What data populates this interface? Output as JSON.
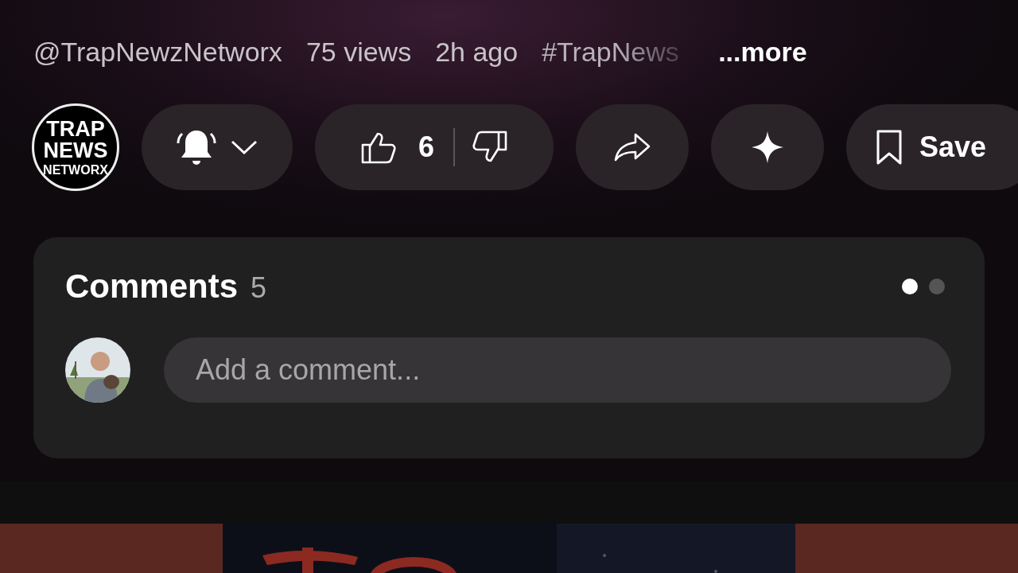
{
  "meta": {
    "channel": "@TrapNewzNetworx",
    "views": "75 views",
    "age": "2h ago",
    "hashtag": "#TrapNews",
    "more": "...more"
  },
  "actions": {
    "channel_logo": [
      "TRAP",
      "NEWS",
      "NETWORX"
    ],
    "like_count": "6",
    "save": "Save",
    "subscribed_bell": true
  },
  "comments": {
    "title": "Comments",
    "count": "5",
    "placeholder": "Add a comment...",
    "pages": [
      {
        "selected": true
      },
      {
        "selected": false
      }
    ]
  }
}
